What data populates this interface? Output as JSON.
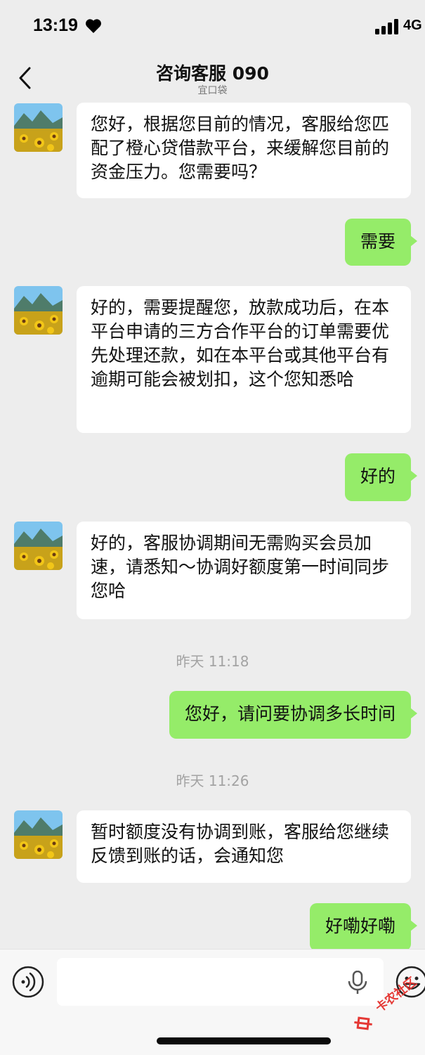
{
  "status_bar": {
    "time": "13:19",
    "network": "4G"
  },
  "header": {
    "title": "咨询客服 090",
    "subtitle": "宜口袋"
  },
  "messages": [
    {
      "side": "left",
      "text": "您好，根据您目前的情况，客服给您匹配了橙心贷借款平台，来缓解您目前的资金压力。您需要吗？"
    },
    {
      "side": "right",
      "text": "需要"
    },
    {
      "side": "left",
      "text": "好的，需要提醒您，放款成功后，在本平台申请的三方合作平台的订单需要优先处理还款，如在本平台或其他平台有逾期可能会被划扣，这个您知悉哈"
    },
    {
      "side": "right",
      "text": "好的"
    },
    {
      "side": "left",
      "text": "好的，客服协调期间无需购买会员加速，请悉知～协调好额度第一时间同步您哈"
    },
    {
      "type": "timestamp",
      "text": "昨天 11:18"
    },
    {
      "side": "right",
      "text": "您好，请问要协调多长时间"
    },
    {
      "type": "timestamp",
      "text": "昨天 11:26"
    },
    {
      "side": "left",
      "text": "暂时额度没有协调到账，客服给您继续反馈到账的话，会通知您"
    },
    {
      "side": "right",
      "text": "好嘞好嘞"
    }
  ],
  "watermark": {
    "text": "卡农社区"
  },
  "icons": {
    "back": "chevron-left-icon",
    "voice": "voice-icon",
    "mic": "microphone-icon",
    "emoji": "emoji-icon"
  },
  "colors": {
    "background": "#ededed",
    "self_bubble": "#95ec69",
    "other_bubble": "#ffffff"
  }
}
